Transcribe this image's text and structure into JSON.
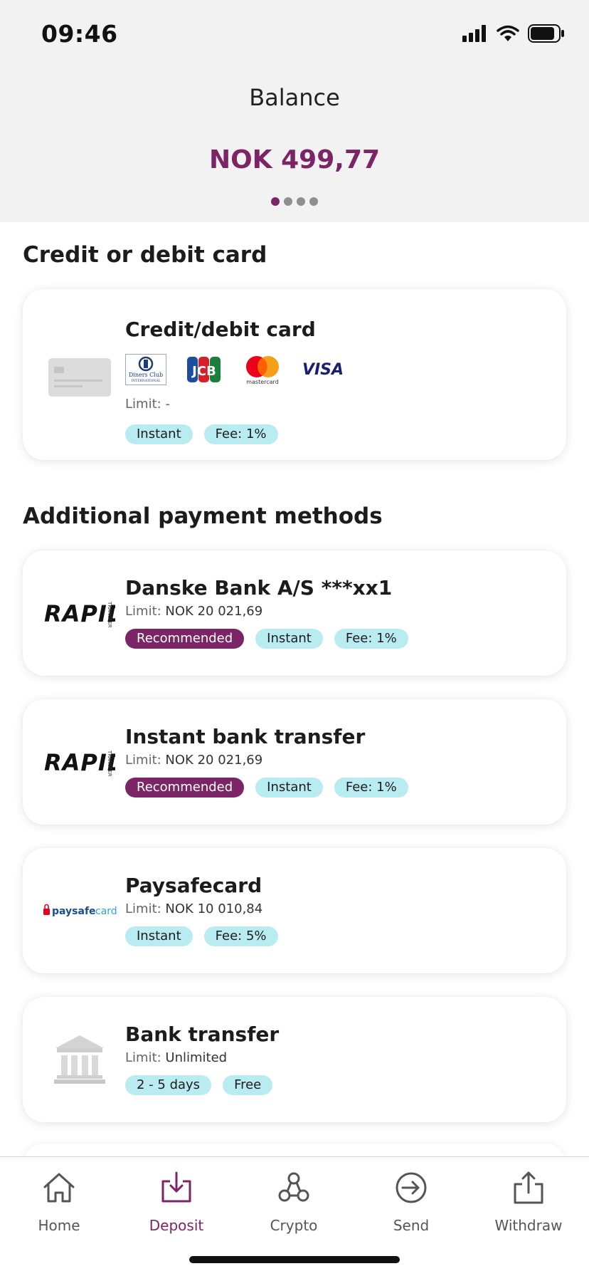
{
  "status_bar": {
    "time": "09:46"
  },
  "header": {
    "title": "Balance",
    "amount": "NOK 499,77",
    "page_count": 4,
    "active_page": 1
  },
  "card_section": {
    "title": "Credit or debit card",
    "card": {
      "title": "Credit/debit card",
      "brands": [
        "Diners Club International",
        "JCB",
        "mastercard",
        "VISA"
      ],
      "diners_text_1": "Diners Club",
      "diners_text_2": "INTERNATIONAL",
      "jcb_text": "JCB",
      "mastercard_text": "mastercard",
      "visa_text": "VISA",
      "limit_label": "Limit: -",
      "tags": [
        "Instant",
        "Fee: 1%"
      ]
    }
  },
  "additional_section": {
    "title": "Additional payment methods",
    "methods": [
      {
        "title": "Danske Bank A/S ***xx1",
        "limit_label": "Limit:",
        "limit_value": "NOK 20 021,69",
        "tags": [
          "Recommended",
          "Instant",
          "Fee: 1%"
        ],
        "logo": "rapid-transfer",
        "logo_text": "RAPID",
        "logo_sub": "TRANSFER"
      },
      {
        "title": "Instant bank transfer",
        "limit_label": "Limit:",
        "limit_value": "NOK 20 021,69",
        "tags": [
          "Recommended",
          "Instant",
          "Fee: 1%"
        ],
        "logo": "rapid-transfer",
        "logo_text": "RAPID",
        "logo_sub": "TRANSFER"
      },
      {
        "title": "Paysafecard",
        "limit_label": "Limit:",
        "limit_value": "NOK 10 010,84",
        "tags": [
          "Instant",
          "Fee: 5%"
        ],
        "logo": "paysafecard",
        "logo_text_1": "paysafe",
        "logo_text_2": "card"
      },
      {
        "title": "Bank transfer",
        "limit_label": "Limit:",
        "limit_value": "Unlimited",
        "tags": [
          "2 - 5 days",
          "Free"
        ],
        "logo": "bank-icon"
      }
    ]
  },
  "tab_bar": {
    "active": "Deposit",
    "tabs": [
      {
        "label": "Home",
        "icon": "home-icon"
      },
      {
        "label": "Deposit",
        "icon": "deposit-icon"
      },
      {
        "label": "Crypto",
        "icon": "crypto-icon"
      },
      {
        "label": "Send",
        "icon": "send-icon"
      },
      {
        "label": "Withdraw",
        "icon": "withdraw-icon"
      }
    ]
  },
  "colors": {
    "accent": "#7b2566",
    "tag": "#b9ecf0",
    "header_bg": "#f2f2f2"
  }
}
